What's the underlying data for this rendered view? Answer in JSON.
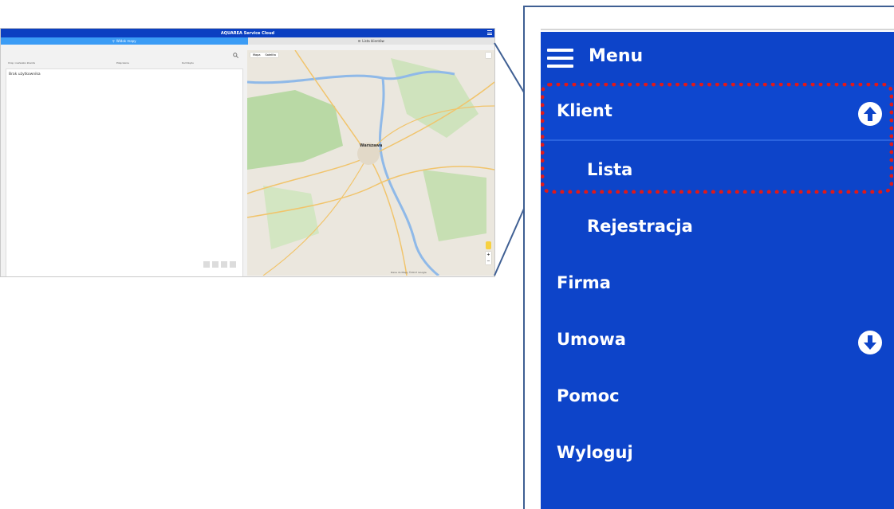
{
  "app_screenshot": {
    "title": "AQUAREA Service Cloud",
    "tabs": [
      {
        "label": "Widok mapy",
        "active": true
      },
      {
        "label": "Lista klientów",
        "active": false
      }
    ],
    "columns": [
      "Imię i nazwisko klienta",
      "Połączenie",
      "Kod błędu"
    ],
    "empty_message": "Brak użytkownika",
    "map": {
      "view_buttons": [
        "Mapa",
        "Satelita"
      ],
      "city_label": "Warszawa",
      "footer_text": "Dane do Mapy ©2017 Google"
    },
    "colors": {
      "header": "#0b3fc1",
      "active_tab": "#3b9cf5"
    }
  },
  "menu": {
    "title": "Menu",
    "items": [
      {
        "label": "Klient",
        "icon": "arrow-up-circle-icon",
        "level": "top",
        "highlighted": true
      },
      {
        "label": "Lista",
        "level": "sub",
        "highlighted": true
      },
      {
        "label": "Rejestracja",
        "level": "sub"
      },
      {
        "label": "Firma",
        "level": "top"
      },
      {
        "label": "Umowa",
        "icon": "arrow-down-circle-icon",
        "level": "top"
      },
      {
        "label": "Pomoc",
        "level": "top"
      },
      {
        "label": "Wyloguj",
        "level": "top"
      }
    ],
    "colors": {
      "background": "#0d44c9",
      "highlight": "#e01919",
      "callout": "#3f5f93"
    }
  }
}
